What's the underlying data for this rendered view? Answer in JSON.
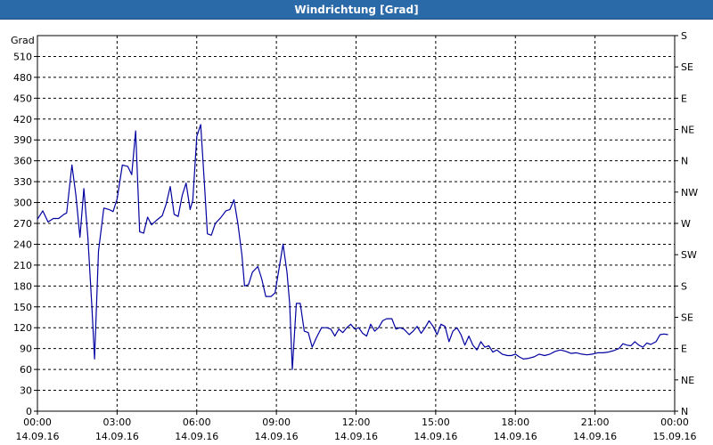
{
  "window": {
    "title": "Windrichtung [Grad]"
  },
  "chart_data": {
    "type": "line",
    "title": "Windrichtung [Grad]",
    "ylabel": "Grad",
    "ylim": [
      0,
      540
    ],
    "yticks": [
      "0",
      "30",
      "60",
      "90",
      "120",
      "150",
      "180",
      "210",
      "240",
      "270",
      "300",
      "330",
      "360",
      "390",
      "420",
      "450",
      "480",
      "510"
    ],
    "right_axis_labels": [
      "N",
      "NE",
      "E",
      "SE",
      "S",
      "SW",
      "W",
      "NW",
      "N",
      "NE",
      "E",
      "SE",
      "S"
    ],
    "xlim_hours": [
      0,
      24
    ],
    "xticks": [
      {
        "time": "00:00",
        "date": "14.09.16"
      },
      {
        "time": "03:00",
        "date": "14.09.16"
      },
      {
        "time": "06:00",
        "date": "14.09.16"
      },
      {
        "time": "09:00",
        "date": "14.09.16"
      },
      {
        "time": "12:00",
        "date": "14.09.16"
      },
      {
        "time": "15:00",
        "date": "14.09.16"
      },
      {
        "time": "18:00",
        "date": "14.09.16"
      },
      {
        "time": "21:00",
        "date": "14.09.16"
      },
      {
        "time": "00:00",
        "date": "15.09.16"
      }
    ],
    "grid": true,
    "line_color": "#0000a0",
    "series": [
      {
        "name": "",
        "points": [
          [
            0.0,
            276
          ],
          [
            0.2,
            288
          ],
          [
            0.4,
            272
          ],
          [
            0.6,
            277
          ],
          [
            0.8,
            277
          ],
          [
            1.0,
            283
          ],
          [
            1.1,
            285
          ],
          [
            1.3,
            354
          ],
          [
            1.45,
            310
          ],
          [
            1.6,
            250
          ],
          [
            1.75,
            320
          ],
          [
            1.9,
            250
          ],
          [
            2.05,
            150
          ],
          [
            2.15,
            75
          ],
          [
            2.3,
            230
          ],
          [
            2.5,
            292
          ],
          [
            2.7,
            290
          ],
          [
            2.85,
            287
          ],
          [
            3.0,
            305
          ],
          [
            3.2,
            354
          ],
          [
            3.4,
            352
          ],
          [
            3.55,
            340
          ],
          [
            3.7,
            403
          ],
          [
            3.85,
            258
          ],
          [
            4.0,
            256
          ],
          [
            4.15,
            279
          ],
          [
            4.3,
            268
          ],
          [
            4.5,
            275
          ],
          [
            4.7,
            281
          ],
          [
            4.85,
            298
          ],
          [
            5.0,
            323
          ],
          [
            5.15,
            283
          ],
          [
            5.3,
            280
          ],
          [
            5.45,
            310
          ],
          [
            5.6,
            328
          ],
          [
            5.75,
            290
          ],
          [
            5.85,
            303
          ],
          [
            6.0,
            395
          ],
          [
            6.15,
            412
          ],
          [
            6.3,
            320
          ],
          [
            6.4,
            255
          ],
          [
            6.55,
            253
          ],
          [
            6.7,
            270
          ],
          [
            6.9,
            278
          ],
          [
            7.1,
            288
          ],
          [
            7.25,
            290
          ],
          [
            7.4,
            304
          ],
          [
            7.55,
            270
          ],
          [
            7.7,
            225
          ],
          [
            7.8,
            180
          ],
          [
            7.95,
            182
          ],
          [
            8.1,
            200
          ],
          [
            8.3,
            208
          ],
          [
            8.45,
            190
          ],
          [
            8.6,
            165
          ],
          [
            8.8,
            165
          ],
          [
            8.95,
            170
          ],
          [
            9.1,
            205
          ],
          [
            9.25,
            240
          ],
          [
            9.4,
            200
          ],
          [
            9.5,
            155
          ],
          [
            9.6,
            60
          ],
          [
            9.75,
            155
          ],
          [
            9.9,
            155
          ],
          [
            10.05,
            115
          ],
          [
            10.2,
            113
          ],
          [
            10.35,
            92
          ],
          [
            10.5,
            105
          ],
          [
            10.7,
            120
          ],
          [
            10.9,
            120
          ],
          [
            11.05,
            118
          ],
          [
            11.2,
            108
          ],
          [
            11.35,
            118
          ],
          [
            11.5,
            113
          ],
          [
            11.65,
            120
          ],
          [
            11.8,
            125
          ],
          [
            11.95,
            118
          ],
          [
            12.1,
            120
          ],
          [
            12.25,
            112
          ],
          [
            12.4,
            108
          ],
          [
            12.55,
            125
          ],
          [
            12.7,
            115
          ],
          [
            12.85,
            120
          ],
          [
            13.0,
            130
          ],
          [
            13.15,
            133
          ],
          [
            13.35,
            133
          ],
          [
            13.5,
            118
          ],
          [
            13.65,
            120
          ],
          [
            13.8,
            118
          ],
          [
            14.0,
            110
          ],
          [
            14.15,
            115
          ],
          [
            14.3,
            122
          ],
          [
            14.45,
            112
          ],
          [
            14.6,
            120
          ],
          [
            14.75,
            130
          ],
          [
            14.9,
            122
          ],
          [
            15.05,
            110
          ],
          [
            15.2,
            125
          ],
          [
            15.35,
            122
          ],
          [
            15.5,
            100
          ],
          [
            15.65,
            115
          ],
          [
            15.8,
            120
          ],
          [
            15.95,
            110
          ],
          [
            16.1,
            95
          ],
          [
            16.25,
            108
          ],
          [
            16.4,
            95
          ],
          [
            16.55,
            88
          ],
          [
            16.7,
            100
          ],
          [
            16.85,
            92
          ],
          [
            17.0,
            94
          ],
          [
            17.15,
            85
          ],
          [
            17.3,
            88
          ],
          [
            17.5,
            82
          ],
          [
            17.7,
            80
          ],
          [
            17.85,
            80
          ],
          [
            18.0,
            82
          ],
          [
            18.15,
            78
          ],
          [
            18.3,
            75
          ],
          [
            18.5,
            76
          ],
          [
            18.7,
            78
          ],
          [
            18.9,
            82
          ],
          [
            19.1,
            80
          ],
          [
            19.3,
            82
          ],
          [
            19.5,
            86
          ],
          [
            19.7,
            88
          ],
          [
            19.9,
            86
          ],
          [
            20.1,
            83
          ],
          [
            20.3,
            84
          ],
          [
            20.5,
            82
          ],
          [
            20.7,
            81
          ],
          [
            20.9,
            82
          ],
          [
            21.1,
            84
          ],
          [
            21.3,
            84
          ],
          [
            21.5,
            85
          ],
          [
            21.7,
            87
          ],
          [
            21.9,
            90
          ],
          [
            22.05,
            97
          ],
          [
            22.2,
            95
          ],
          [
            22.35,
            94
          ],
          [
            22.5,
            100
          ],
          [
            22.65,
            95
          ],
          [
            22.8,
            92
          ],
          [
            22.95,
            98
          ],
          [
            23.1,
            96
          ],
          [
            23.3,
            100
          ],
          [
            23.45,
            110
          ],
          [
            23.6,
            111
          ],
          [
            23.75,
            110
          ]
        ]
      }
    ]
  }
}
